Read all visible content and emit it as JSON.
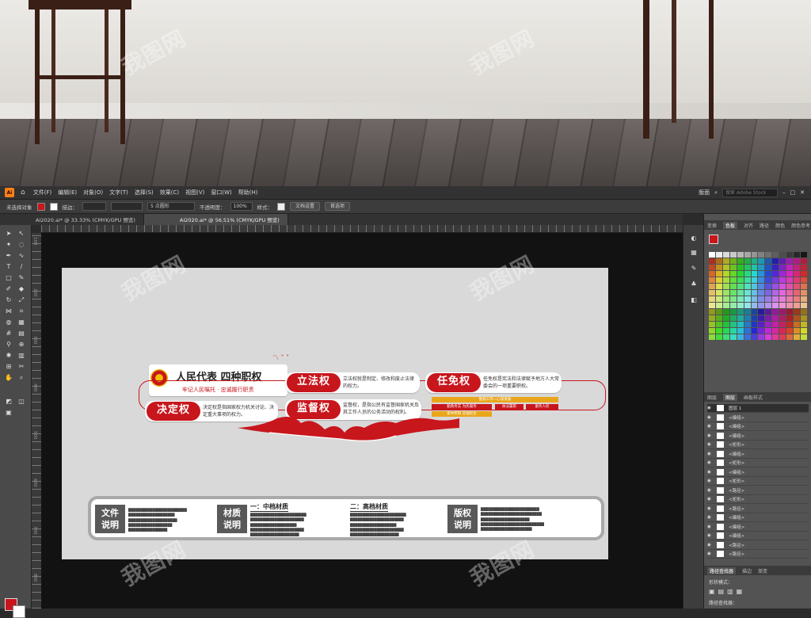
{
  "menubar": {
    "app_icon": "Ai",
    "items": [
      "文件(F)",
      "编辑(E)",
      "对象(O)",
      "文字(T)",
      "选择(S)",
      "效果(C)",
      "视图(V)",
      "窗口(W)",
      "帮助(H)"
    ],
    "workspace": "版面",
    "search_placeholder": "搜索 Adobe Stock"
  },
  "control_bar": {
    "selection": "未选择对象",
    "stroke_label": "描边：",
    "brush_size": "5 点圆形",
    "opacity_label": "不透明度：",
    "opacity_value": "100%",
    "style_label": "样式：",
    "doc_setup": "文档设置",
    "prefs": "首选项"
  },
  "doc_tabs": [
    "AI2020.ai* @ 33.33% (CMYK/GPU 预览)",
    "AI2020.ai* @ 56.51% (CMYK/GPU 预览)"
  ],
  "ruler_marks": [
    "100",
    "200",
    "300",
    "400",
    "500",
    "600",
    "700",
    "800"
  ],
  "design": {
    "title": "人民代表 四种职权",
    "subtitle": "牢记人民嘱托 · 忠诚履行职责",
    "powers": [
      {
        "name": "立法权",
        "desc": "立法权就是制定、修改和废止法律的权力。"
      },
      {
        "name": "任免权",
        "desc": "任免权是宪法和法律赋予地方人大常委会的一项重要职权。"
      },
      {
        "name": "决定权",
        "desc": "决定权是指国家权力机关讨论、决定重大事项的权力。"
      },
      {
        "name": "监督权",
        "desc": "监督权，是指公民有监督国家机关及其工作人员的公务活动的权利。"
      }
    ],
    "tags": [
      "勤勉工作一心谋发展",
      "勤政务实 为民服务",
      "依法履职",
      "服务人民",
      "紧中所盼 造福民生"
    ],
    "bottom": {
      "file_label": "文件\n说明",
      "material_label": "材质\n说明",
      "mid_title": "一：中档材质",
      "high_title": "二：高档材质",
      "copyright_label": "版权\n说明"
    }
  },
  "right_panel": {
    "top_tabs": [
      "变换",
      "色板",
      "对齐",
      "路径",
      "颜色",
      "颜色参考"
    ],
    "layers_tabs": [
      "图层",
      "图层",
      "画板样式"
    ],
    "layers": [
      {
        "name": "图层 1",
        "color": "#ff3b3b"
      },
      {
        "name": "<编组>"
      },
      {
        "name": "<编组>"
      },
      {
        "name": "<编组>"
      },
      {
        "name": "<矩形>"
      },
      {
        "name": "<编组>"
      },
      {
        "name": "<矩形>"
      },
      {
        "name": "<编组>"
      },
      {
        "name": "<矩形>"
      },
      {
        "name": "<路径>"
      },
      {
        "name": "<矩形>"
      },
      {
        "name": "<路径>"
      },
      {
        "name": "<编组>"
      },
      {
        "name": "<编组>"
      },
      {
        "name": "<编组>"
      },
      {
        "name": "<路径>"
      },
      {
        "name": "<路径>"
      }
    ],
    "pathfinder_tabs": [
      "路径查找器",
      "描边",
      "渐变"
    ],
    "shape_modes": "形状模式：",
    "pathfinder_label": "路径查找器："
  },
  "watermark": "我图网",
  "colors": {
    "accent": "#c8161d",
    "ui_dark": "#323232",
    "ui_mid": "#535353"
  }
}
